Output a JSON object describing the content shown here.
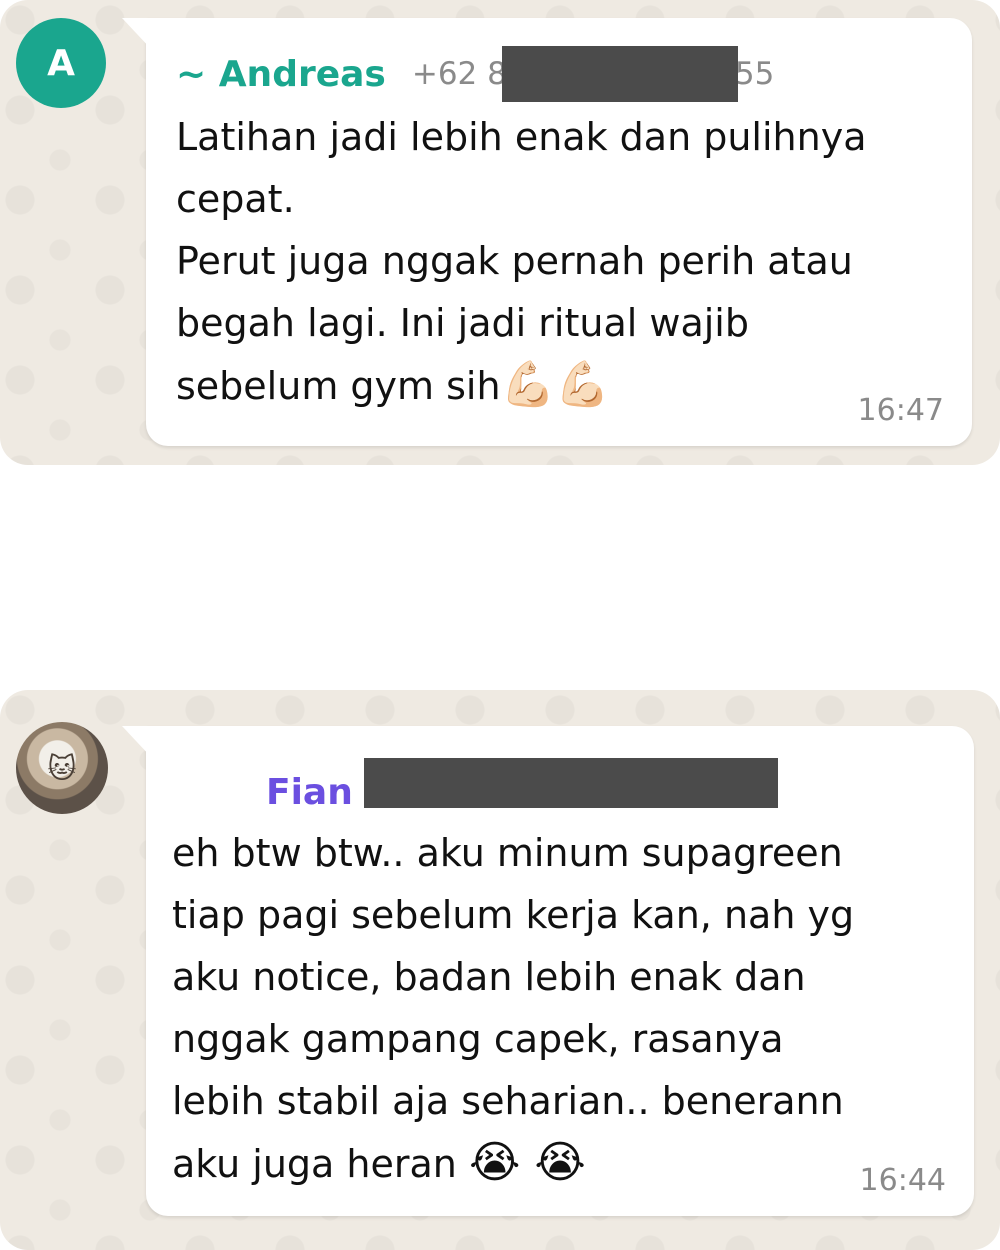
{
  "messages": [
    {
      "avatar_letter": "A",
      "avatar_color": "#1aa68e",
      "sender": "~ Andreas",
      "sender_color": "#1aa68e",
      "phone_prefix": "+62 8",
      "phone_suffix": "55",
      "text": "Latihan jadi lebih enak dan pulihnya\ncepat.\nPerut juga nggak pernah perih atau\nbegah lagi. Ini jadi ritual wajib\nsebelum gym sih",
      "emojis": "💪🏻💪🏻",
      "time": "16:47"
    },
    {
      "sender": "Fian",
      "sender_color": "#6b4fe0",
      "text": "eh btw btw.. aku minum supagreen\ntiap pagi sebelum kerja kan, nah yg\naku notice, badan lebih enak dan\nnggak gampang capek, rasanya\nlebih stabil aja seharian.. benerann\naku juga heran ",
      "emojis": "😭 😭",
      "time": "16:44"
    }
  ]
}
